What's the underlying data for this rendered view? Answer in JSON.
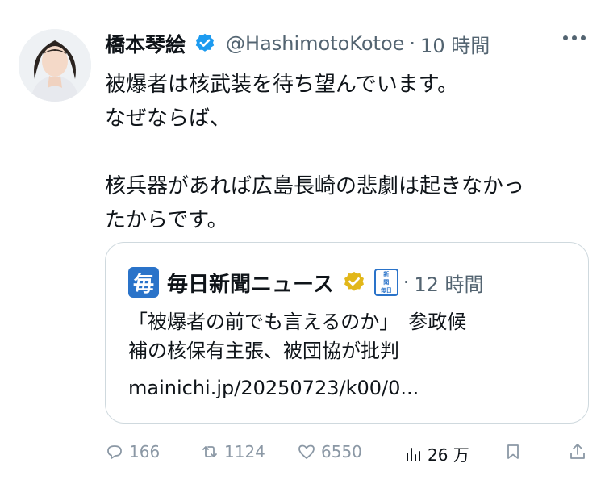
{
  "tweet": {
    "author_name": "橋本琴絵",
    "handle": "@HashimotoKotoe",
    "separator": "·",
    "time": "10 時間",
    "lines": [
      "被爆者は核武装を待ち望んでいます。",
      "なぜならば、",
      "",
      "核兵器があれば広島長崎の悲劇は起きなかっ",
      "たからです。"
    ]
  },
  "card": {
    "logo_char": "毎",
    "name": "毎日新聞ニュース",
    "paper_chars": [
      "新",
      "聞",
      "毎日"
    ],
    "separator": "·",
    "time": "12 時間",
    "text_line1": "「被爆者の前でも言えるのか」　参政候",
    "text_line2": "補の核保有主張、被団協が批判",
    "link": "mainichi.jp/20250723/k00/0..."
  },
  "actions": {
    "replies": "166",
    "reposts": "1124",
    "likes": "6550",
    "views": "26 万"
  },
  "colors": {
    "verified_blue": "#1d9bf0",
    "verified_gold": "#e2b719",
    "mainichi_blue": "#2a73c9",
    "secondary_text": "#536471"
  }
}
